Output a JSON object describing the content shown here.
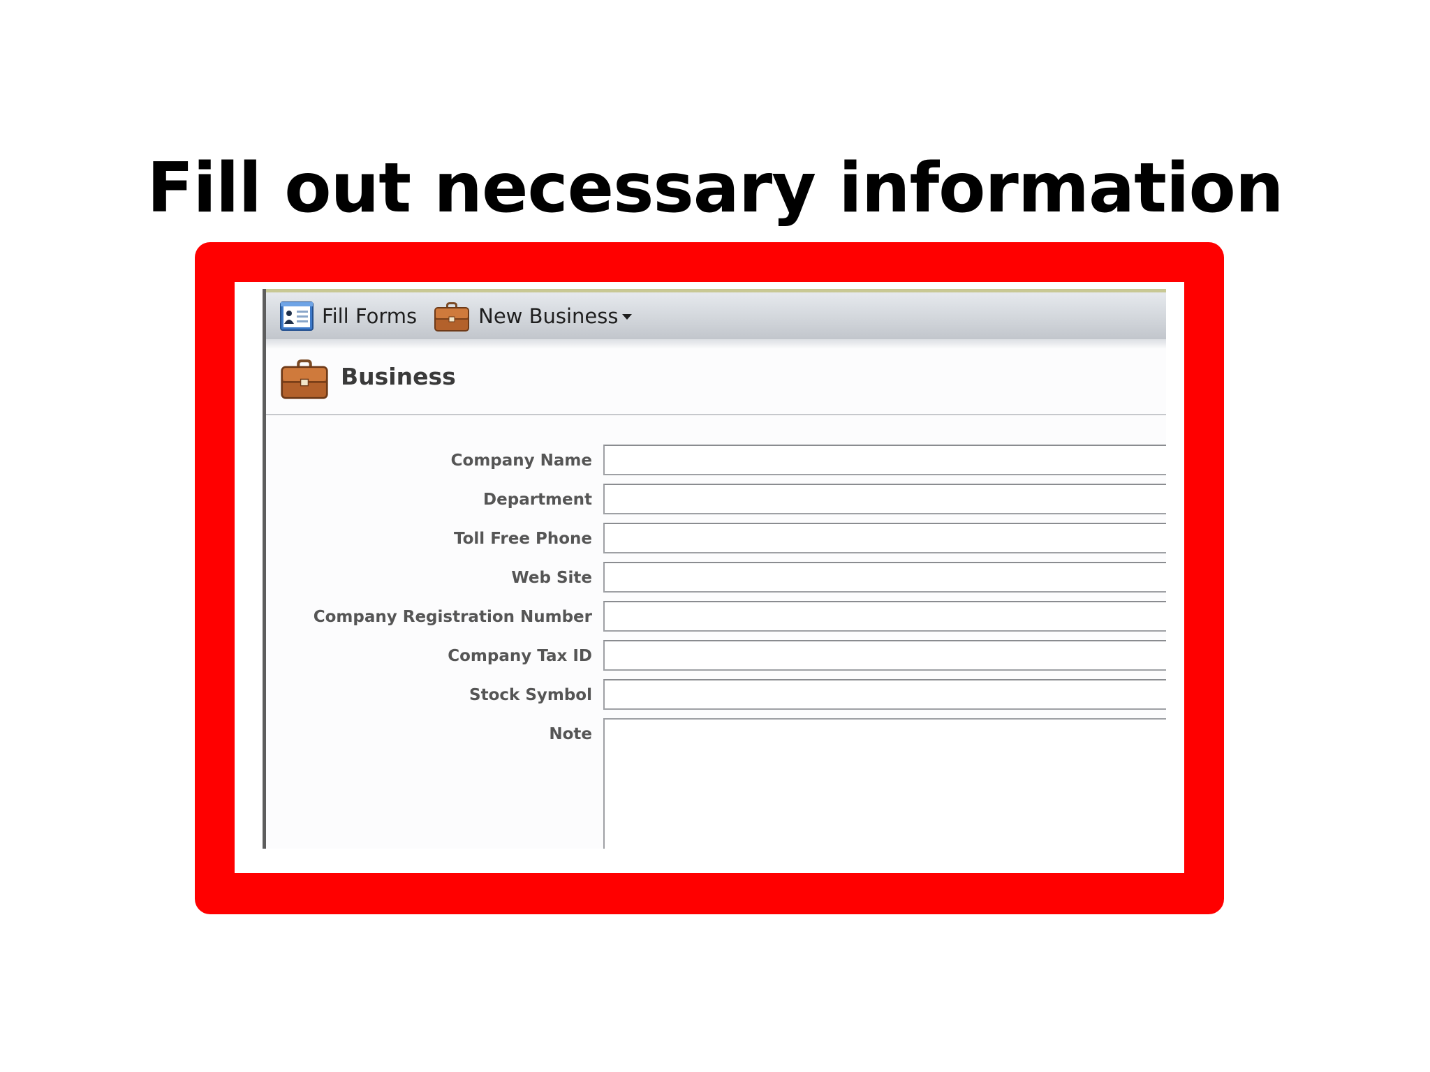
{
  "slide": {
    "title": "Fill out necessary information"
  },
  "colors": {
    "highlight_frame": "#ff0000",
    "toolbar_gradient_top": "#e6e9ed",
    "toolbar_gradient_bottom": "#c2c6cc",
    "label_text": "#555555"
  },
  "toolbar": {
    "fill_forms_label": "Fill Forms",
    "fill_forms_icon": "forms-icon",
    "new_business_label": "New Business",
    "new_business_icon": "briefcase-icon"
  },
  "section": {
    "title": "Business",
    "icon": "briefcase-icon"
  },
  "form": {
    "fields": [
      {
        "label": "Company Name",
        "value": ""
      },
      {
        "label": "Department",
        "value": ""
      },
      {
        "label": "Toll Free Phone",
        "value": ""
      },
      {
        "label": "Web Site",
        "value": ""
      },
      {
        "label": "Company Registration Number",
        "value": ""
      },
      {
        "label": "Company Tax ID",
        "value": ""
      },
      {
        "label": "Stock Symbol",
        "value": ""
      },
      {
        "label": "Note",
        "value": ""
      }
    ]
  }
}
